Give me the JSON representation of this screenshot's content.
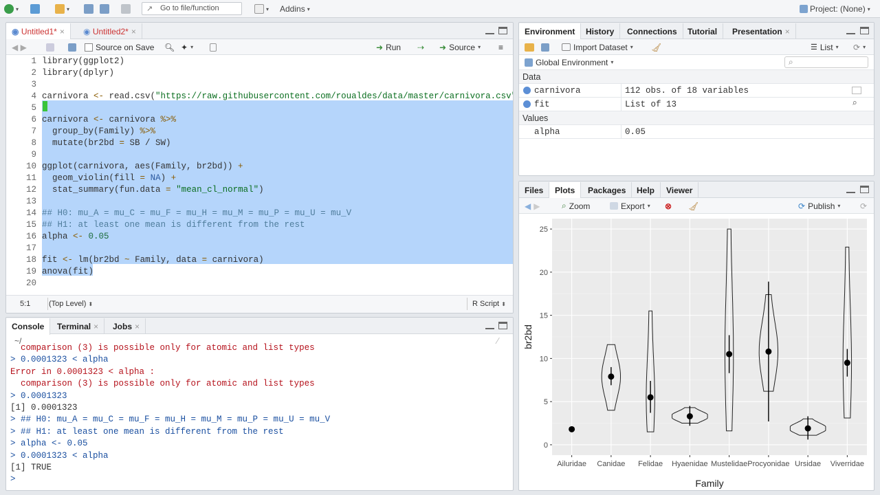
{
  "toolbar": {
    "goto_placeholder": "Go to file/function",
    "addins_label": "Addins",
    "project_label": "Project: (None)"
  },
  "editor": {
    "tabs": [
      {
        "label": "Untitled1*"
      },
      {
        "label": "Untitled2*"
      }
    ],
    "source_on_save": "Source on Save",
    "run_label": "Run",
    "source_label": "Source",
    "line_numbers": [
      "1",
      "2",
      "3",
      "4",
      "5",
      "6",
      "7",
      "8",
      "9",
      "10",
      "11",
      "12",
      "13",
      "14",
      "15",
      "16",
      "17",
      "18",
      "19",
      "20"
    ],
    "lines": [
      "library(ggplot2)",
      "library(dplyr)",
      "",
      "carnivora <- read.csv(\"https://raw.githubusercontent.com/roualdes/data/master/carnivora.csv\")",
      "",
      "carnivora <- carnivora %>%",
      "  group_by(Family) %>%",
      "  mutate(br2bd = SB / SW)",
      "",
      "ggplot(carnivora, aes(Family, br2bd)) +",
      "  geom_violin(fill = NA) +",
      "  stat_summary(fun.data = \"mean_cl_normal\")",
      "",
      "## H0: mu_A = mu_C = mu_F = mu_H = mu_M = mu_P = mu_U = mu_V",
      "## H1: at least one mean is different from the rest",
      "alpha <- 0.05",
      "",
      "fit <- lm(br2bd ~ Family, data = carnivora)",
      "anova(fit)",
      ""
    ],
    "cursor_pos": "5:1",
    "scope": "(Top Level)",
    "file_type": "R Script"
  },
  "console": {
    "tabs": [
      {
        "label": "Console"
      },
      {
        "label": "Terminal"
      },
      {
        "label": "Jobs"
      }
    ],
    "path": "~/",
    "lines": [
      {
        "t": "  comparison (3) is possible only for atomic and list types",
        "c": "err"
      },
      {
        "t": "> 0.0001323 < alpha",
        "c": "prompt"
      },
      {
        "t": "Error in 0.0001323 < alpha :",
        "c": "err"
      },
      {
        "t": "  comparison (3) is possible only for atomic and list types",
        "c": "err"
      },
      {
        "t": "> 0.0001323",
        "c": "prompt"
      },
      {
        "t": "[1] 0.0001323",
        "c": "plain"
      },
      {
        "t": "> ## H0: mu_A = mu_C = mu_F = mu_H = mu_M = mu_P = mu_U = mu_V",
        "c": "prompt"
      },
      {
        "t": "> ## H1: at least one mean is different from the rest",
        "c": "prompt"
      },
      {
        "t": "> alpha <- 0.05",
        "c": "prompt"
      },
      {
        "t": "> 0.0001323 < alpha",
        "c": "prompt"
      },
      {
        "t": "[1] TRUE",
        "c": "plain"
      },
      {
        "t": "> ",
        "c": "prompt"
      }
    ]
  },
  "environment": {
    "tabs": [
      {
        "label": "Environment"
      },
      {
        "label": "History"
      },
      {
        "label": "Connections"
      },
      {
        "label": "Tutorial"
      },
      {
        "label": "Presentation"
      }
    ],
    "import_label": "Import Dataset",
    "list_label": "List",
    "scope_label": "Global Environment",
    "data_header": "Data",
    "values_header": "Values",
    "data_rows": [
      {
        "name": "carnivora",
        "value": "112 obs. of 18 variables"
      },
      {
        "name": "fit",
        "value": "List of 13"
      }
    ],
    "value_rows": [
      {
        "name": "alpha",
        "value": "0.05"
      }
    ]
  },
  "files": {
    "tabs": [
      {
        "label": "Files"
      },
      {
        "label": "Plots"
      },
      {
        "label": "Packages"
      },
      {
        "label": "Help"
      },
      {
        "label": "Viewer"
      }
    ],
    "zoom_label": "Zoom",
    "export_label": "Export",
    "publish_label": "Publish"
  },
  "chart_data": {
    "type": "violin",
    "xlabel": "Family",
    "ylabel": "br2bd",
    "ylim": [
      0,
      26
    ],
    "yticks": [
      0,
      5,
      10,
      15,
      20,
      25
    ],
    "categories": [
      "Ailuridae",
      "Canidae",
      "Felidae",
      "Hyaenidae",
      "Mustelidae",
      "Procyonidae",
      "Ursidae",
      "Viverridae"
    ],
    "means": [
      1.8,
      7.9,
      5.5,
      3.3,
      10.5,
      10.8,
      1.9,
      9.5
    ],
    "ci_low": [
      null,
      6.9,
      3.7,
      2.2,
      8.3,
      2.7,
      0.6,
      7.9
    ],
    "ci_high": [
      null,
      9.0,
      7.4,
      4.5,
      12.7,
      18.9,
      3.3,
      11.1
    ],
    "ranges": [
      [
        1.8,
        1.8
      ],
      [
        4.0,
        11.6
      ],
      [
        1.5,
        15.5
      ],
      [
        2.5,
        4.3
      ],
      [
        1.6,
        25.0
      ],
      [
        6.2,
        17.4
      ],
      [
        1.1,
        3.0
      ],
      [
        3.1,
        22.9
      ]
    ],
    "background": "#ebebeb",
    "grid": true
  }
}
